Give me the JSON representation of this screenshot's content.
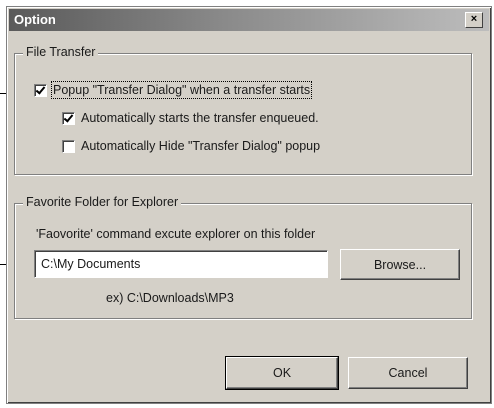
{
  "window": {
    "title": "Option",
    "close_label": "×"
  },
  "file_transfer": {
    "group_title": "File Transfer",
    "popup_dialog": {
      "label": "Popup \"Transfer Dialog\" when a transfer starts",
      "checked": true
    },
    "auto_start": {
      "label": "Automatically starts the transfer enqueued.",
      "checked": true
    },
    "auto_hide": {
      "label": "Automatically Hide \"Transfer Dialog\" popup",
      "checked": false
    }
  },
  "favorite_folder": {
    "group_title": "Favorite Folder for Explorer",
    "description": "'Faovorite' command excute explorer on this folder",
    "folder_value": "C:\\My Documents",
    "browse_label": "Browse...",
    "example": "ex) C:\\Downloads\\MP3"
  },
  "buttons": {
    "ok_label": "OK",
    "cancel_label": "Cancel"
  }
}
